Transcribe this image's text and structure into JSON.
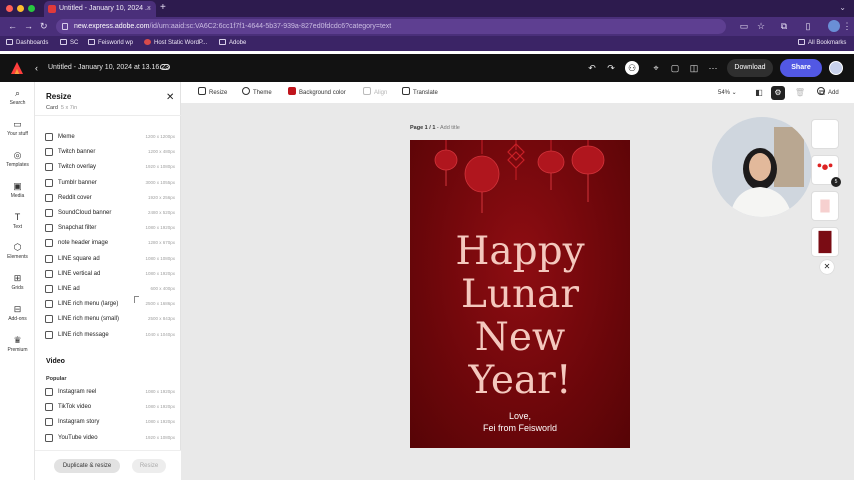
{
  "browser": {
    "tab_title": "Untitled - January 10, 2024 ...",
    "tab_close": "×",
    "new_tab": "+",
    "url_host": "new.express.adobe.com",
    "url_path": "/id/urn:aaid:sc:VA6C2:6cc1f7f1-4644-5b37-939a-827ed0fdcdc6?category=text",
    "bookmarks": [
      "Dashboards",
      "SC",
      "Feisworld wp",
      "Host Static WordP...",
      "Adobe"
    ],
    "all_bookmarks": "All Bookmarks"
  },
  "app": {
    "document_title": "Untitled - January 10, 2024 at 13.16.23",
    "download_label": "Download",
    "share_label": "Share"
  },
  "rail": {
    "items": [
      "Search",
      "Your stuff",
      "Templates",
      "Media",
      "Text",
      "Elements",
      "Grids",
      "Add-ons",
      "Premium"
    ]
  },
  "panel": {
    "title": "Resize",
    "subtitle": "Card",
    "subtitle_dim": "5 x 7in",
    "formats": [
      {
        "label": "Meme",
        "size": "1200 x 1200px"
      },
      {
        "label": "Twitch banner",
        "size": "1200 x 480px"
      },
      {
        "label": "Twitch overlay",
        "size": "1920 x 1080px"
      },
      {
        "label": "Tumblr banner",
        "size": "3000 x 1055px"
      },
      {
        "label": "Reddit cover",
        "size": "1920 x 256px"
      },
      {
        "label": "SoundCloud banner",
        "size": "2480 x 520px"
      },
      {
        "label": "Snapchat filter",
        "size": "1080 x 1920px"
      },
      {
        "label": "note header image",
        "size": "1280 x 670px"
      },
      {
        "label": "LINE square ad",
        "size": "1080 x 1080px"
      },
      {
        "label": "LINE vertical ad",
        "size": "1080 x 1920px"
      },
      {
        "label": "LINE ad",
        "size": "600 x 400px"
      },
      {
        "label": "LINE rich menu (large)",
        "size": "2500 x 1686px"
      },
      {
        "label": "LINE rich menu (small)",
        "size": "2500 x 843px"
      },
      {
        "label": "LINE rich message",
        "size": "1040 x 1040px"
      }
    ],
    "video_section": "Video",
    "popular_label": "Popular",
    "video_formats": [
      {
        "label": "Instagram reel",
        "size": "1080 x 1920px"
      },
      {
        "label": "TikTok video",
        "size": "1080 x 1920px"
      },
      {
        "label": "Instagram story",
        "size": "1080 x 1920px"
      },
      {
        "label": "YouTube video",
        "size": "1920 x 1080px"
      }
    ],
    "duplicate_label": "Duplicate & resize",
    "resize_label": "Resize"
  },
  "toolbar": {
    "resize": "Resize",
    "theme": "Theme",
    "background_color": "Background color",
    "align": "Align",
    "translate": "Translate",
    "zoom": "54%",
    "add": "Add"
  },
  "canvas": {
    "page_label": "Page 1 / 1",
    "add_title": "Add title",
    "headline": [
      "Happy",
      "Lunar",
      "New",
      "Year!"
    ],
    "signoff_1": "Love,",
    "signoff_2": "Fei from Feisworld",
    "page_count_badge": "5"
  },
  "colors": {
    "accent_share": "#5258e4",
    "card_red": "#7a080d",
    "headline_pink": "#f4c8be"
  }
}
